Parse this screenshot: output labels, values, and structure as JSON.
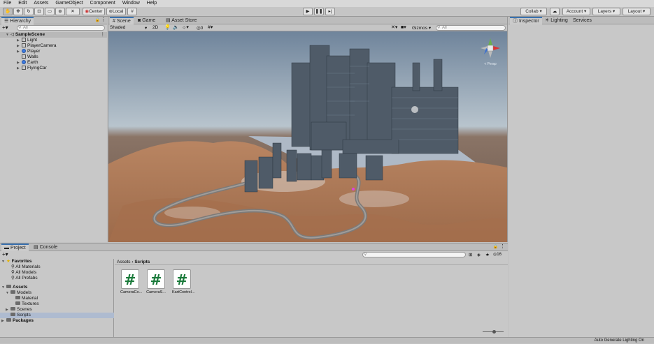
{
  "menu": [
    "File",
    "Edit",
    "Assets",
    "GameObject",
    "Component",
    "Window",
    "Help"
  ],
  "toolbar": {
    "pivot_mode": "Center",
    "pivot_space": "Local",
    "collab": "Collab",
    "account": "Account",
    "layers": "Layers",
    "layout": "Layout"
  },
  "hierarchy": {
    "tab": "Hierarchy",
    "search_placeholder": "All",
    "scene": "SampleScene",
    "items": [
      "Light",
      "PlayerCamera",
      "Player",
      "Walls",
      "Earth",
      "FlyingCar"
    ]
  },
  "scene_view": {
    "tabs": [
      "Scene",
      "Game",
      "Asset Store"
    ],
    "shading": "Shaded",
    "mode_2d": "2D",
    "fx_count": "0",
    "gizmos": "Gizmos",
    "search_placeholder": "All",
    "persp_label": "< Persp"
  },
  "inspector": {
    "tabs": [
      "Inspector",
      "Lighting",
      "Services"
    ]
  },
  "project": {
    "tabs": [
      "Project",
      "Console"
    ],
    "favorites_label": "Favorites",
    "favorites": [
      "All Materials",
      "All Models",
      "All Prefabs"
    ],
    "assets_label": "Assets",
    "assets_tree": [
      "Models",
      "Material",
      "Textures",
      "Scenes",
      "Scripts"
    ],
    "packages_label": "Packages",
    "breadcrumb": [
      "Assets",
      "Scripts"
    ],
    "hidden_count": "16",
    "files": [
      "CameraCo...",
      "CameraS...",
      "KartControl..."
    ]
  },
  "status_bar": "Auto Generate Lighting On",
  "colors": {
    "accent": "#3a72b0",
    "selection": "#8fa9d0",
    "sky_top": "#7d8fa3",
    "sky_horizon": "#b7c3cd",
    "ground": "#b07a58"
  }
}
